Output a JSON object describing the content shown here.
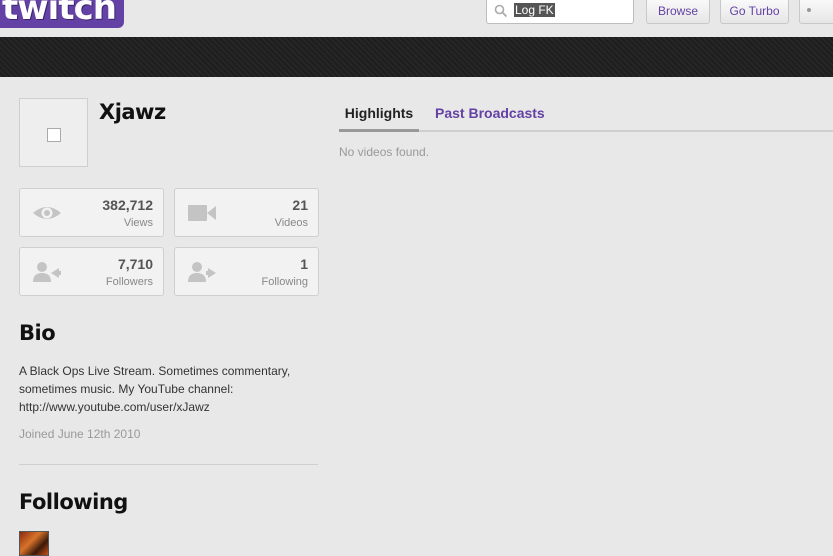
{
  "header": {
    "logo_text": "twitch",
    "search_value": "Log FK",
    "browse_label": "Browse",
    "turbo_label": "Go Turbo",
    "brand_color": "#6441a5"
  },
  "channel": {
    "name": "Xjawz",
    "avatar_icon": "broken-image-icon"
  },
  "stats": {
    "views": {
      "value": "382,712",
      "label": "Views",
      "icon": "eye-icon"
    },
    "videos": {
      "value": "21",
      "label": "Videos",
      "icon": "video-camera-icon"
    },
    "followers": {
      "value": "7,710",
      "label": "Followers",
      "icon": "followers-icon"
    },
    "following": {
      "value": "1",
      "label": "Following",
      "icon": "following-icon"
    }
  },
  "bio": {
    "title": "Bio",
    "text": "A Black Ops Live Stream. Sometimes commentary, sometimes music. My YouTube channel: http://www.youtube.com/user/xJawz",
    "joined": "Joined June 12th 2010"
  },
  "following": {
    "title": "Following"
  },
  "tabs": {
    "highlights": "Highlights",
    "past_broadcasts": "Past Broadcasts",
    "active": "Highlights"
  },
  "videos": {
    "empty_message": "No videos found."
  }
}
